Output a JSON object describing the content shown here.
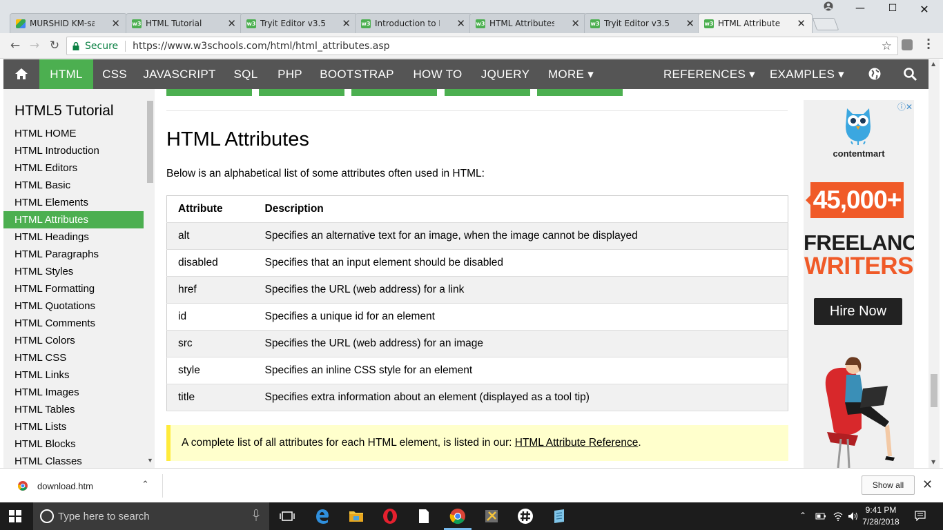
{
  "browser": {
    "tabs": [
      {
        "label": "MURSHID KM-samp",
        "icon": "google-drive-icon",
        "active": false
      },
      {
        "label": "HTML Tutorial",
        "icon": "w3schools-icon",
        "active": false
      },
      {
        "label": "Tryit Editor v3.5",
        "icon": "w3schools-icon",
        "active": false
      },
      {
        "label": "Introduction to HTM",
        "icon": "w3schools-icon",
        "active": false
      },
      {
        "label": "HTML Attributes",
        "icon": "w3schools-icon",
        "active": false
      },
      {
        "label": "Tryit Editor v3.5",
        "icon": "w3schools-icon",
        "active": false
      },
      {
        "label": "HTML Attributes",
        "icon": "w3schools-icon",
        "active": true
      }
    ],
    "secure_label": "Secure",
    "url": "https://www.w3schools.com/html/html_attributes.asp"
  },
  "topnav": {
    "items": [
      "HTML",
      "CSS",
      "JAVASCRIPT",
      "SQL",
      "PHP",
      "BOOTSTRAP",
      "HOW TO",
      "JQUERY",
      "MORE ▾",
      "REFERENCES ▾",
      "EXAMPLES ▾"
    ],
    "active": "HTML"
  },
  "sidebar": {
    "title": "HTML5 Tutorial",
    "items": [
      "HTML HOME",
      "HTML Introduction",
      "HTML Editors",
      "HTML Basic",
      "HTML Elements",
      "HTML Attributes",
      "HTML Headings",
      "HTML Paragraphs",
      "HTML Styles",
      "HTML Formatting",
      "HTML Quotations",
      "HTML Comments",
      "HTML Colors",
      "HTML CSS",
      "HTML Links",
      "HTML Images",
      "HTML Tables",
      "HTML Lists",
      "HTML Blocks",
      "HTML Classes"
    ],
    "active": "HTML Attributes"
  },
  "main": {
    "heading": "HTML Attributes",
    "intro": "Below is an alphabetical list of some attributes often used in HTML:",
    "table": {
      "headers": [
        "Attribute",
        "Description"
      ],
      "rows": [
        [
          "alt",
          "Specifies an alternative text for an image, when the image cannot be displayed"
        ],
        [
          "disabled",
          "Specifies that an input element should be disabled"
        ],
        [
          "href",
          "Specifies the URL (web address) for a link"
        ],
        [
          "id",
          "Specifies a unique id for an element"
        ],
        [
          "src",
          "Specifies the URL (web address) for an image"
        ],
        [
          "style",
          "Specifies an inline CSS style for an element"
        ],
        [
          "title",
          "Specifies extra information about an element (displayed as a tool tip)"
        ]
      ]
    },
    "note_text": "A complete list of all attributes for each HTML element, is listed in our: ",
    "note_link": "HTML Attribute Reference",
    "note_end": "."
  },
  "ad": {
    "brand": "contentmart",
    "badge": "45,000+",
    "line1": "FREELANCE",
    "line2": "WRITERS",
    "cta": "Hire Now"
  },
  "download_bar": {
    "file": "download.htm",
    "show_all": "Show all"
  },
  "taskbar": {
    "search_placeholder": "Type here to search",
    "time": "9:41 PM",
    "date": "7/28/2018"
  },
  "colors": {
    "w3_green": "#4caf50",
    "nav_gray": "#555555",
    "ad_orange": "#f05a28",
    "note_yellow": "#ffffcc"
  }
}
